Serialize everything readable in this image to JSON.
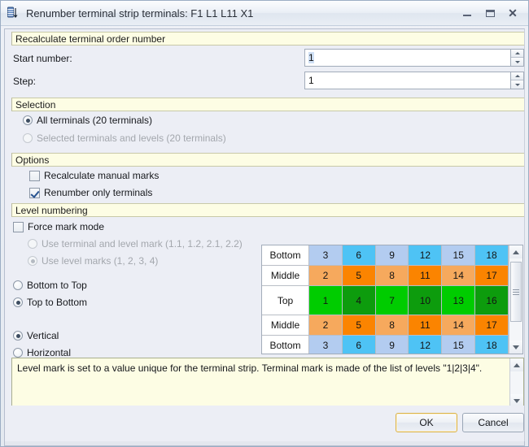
{
  "window": {
    "title": "Renumber terminal strip terminals: F1 L1 L11 X1",
    "icon": "terminal-strip-renumber-icon",
    "minimize_label": "Minimize",
    "maximize_label": "Maximize",
    "close_label": "Close"
  },
  "recalculate_section": {
    "header": "Recalculate terminal order number",
    "start_number": {
      "label": "Start number:",
      "value": "1",
      "selected": true
    },
    "step": {
      "label": "Step:",
      "value": "1",
      "selected": false
    }
  },
  "selection_section": {
    "header": "Selection",
    "options": [
      {
        "label": "All terminals (20 terminals)",
        "checked": true,
        "disabled": false
      },
      {
        "label": "Selected terminals and levels (20 terminals)",
        "checked": false,
        "disabled": true
      }
    ]
  },
  "options_section": {
    "header": "Options",
    "checkboxes": [
      {
        "label": "Recalculate manual marks",
        "checked": false
      },
      {
        "label": "Renumber only terminals",
        "checked": true
      }
    ]
  },
  "level_numbering_section": {
    "header": "Level numbering",
    "force_mark_mode": {
      "label": "Force mark mode",
      "checked": false
    },
    "mark_mode_options": [
      {
        "label": "Use terminal and level mark (1.1, 1.2, 2.1, 2.2)",
        "checked": false,
        "disabled": true
      },
      {
        "label": "Use level marks (1, 2, 3, 4)",
        "checked": true,
        "disabled": true
      }
    ],
    "direction_options": [
      {
        "label": "Bottom to Top",
        "checked": false
      },
      {
        "label": "Top to Bottom",
        "checked": true
      }
    ],
    "orientation_options": [
      {
        "label": "Vertical",
        "checked": true
      },
      {
        "label": "Horizontal",
        "checked": false
      }
    ]
  },
  "preview_grid": {
    "rows": [
      {
        "label": "Bottom",
        "values": [
          "3",
          "6",
          "9",
          "12",
          "15",
          "18"
        ],
        "tall": false,
        "colors": [
          "#b3ccf0",
          "#4ec3f5",
          "#b3ccf0",
          "#4ec3f5",
          "#b3ccf0",
          "#4ec3f5"
        ]
      },
      {
        "label": "Middle",
        "values": [
          "2",
          "5",
          "8",
          "11",
          "14",
          "17"
        ],
        "tall": false,
        "colors": [
          "#f6a95d",
          "#fb8400",
          "#f6a95d",
          "#fb8400",
          "#f6a95d",
          "#fb8400"
        ]
      },
      {
        "label": "Top",
        "values": [
          "1",
          "4",
          "7",
          "10",
          "13",
          "16"
        ],
        "tall": true,
        "colors": [
          "#00cc00",
          "#0d9c0d",
          "#00cc00",
          "#0d9c0d",
          "#00cc00",
          "#0d9c0d"
        ]
      },
      {
        "label": "Middle",
        "values": [
          "2",
          "5",
          "8",
          "11",
          "14",
          "17"
        ],
        "tall": false,
        "colors": [
          "#f6a95d",
          "#fb8400",
          "#f6a95d",
          "#fb8400",
          "#f6a95d",
          "#fb8400"
        ]
      },
      {
        "label": "Bottom",
        "values": [
          "3",
          "6",
          "9",
          "12",
          "15",
          "18"
        ],
        "tall": false,
        "colors": [
          "#b3ccf0",
          "#4ec3f5",
          "#b3ccf0",
          "#4ec3f5",
          "#b3ccf0",
          "#4ec3f5"
        ]
      }
    ],
    "scroll_up_icon": "scroll-up-arrow-icon",
    "scroll_down_icon": "scroll-down-arrow-icon"
  },
  "info_panel": {
    "text": "Level mark is set to a value unique for the terminal strip. Terminal mark is made of the list of levels \"1|2|3|4\"."
  },
  "footer": {
    "ok_label": "OK",
    "cancel_label": "Cancel"
  }
}
